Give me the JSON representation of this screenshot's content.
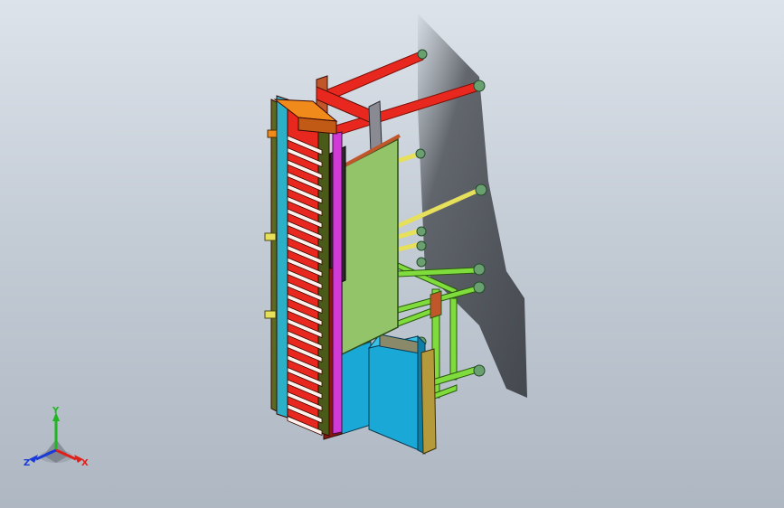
{
  "viewport": {
    "background_top": "#dde3ea",
    "background_bottom": "#aeb7c2"
  },
  "colors": {
    "red": "#e8281e",
    "dark_red": "#9c1a12",
    "orange": "#f08a1a",
    "green_panel": "#94c46a",
    "green_frame": "#7fdc3c",
    "yellow_arm": "#e6e05a",
    "cyan_box": "#1aa9d6",
    "olive": "#b49a3a",
    "magenta": "#d23ad8",
    "teal": "#2bb0c8",
    "shadow": "#55595f"
  },
  "triad": {
    "x_label": "X",
    "y_label": "Y",
    "z_label": "Z",
    "x_color": "#e0201a",
    "y_color": "#22b422",
    "z_color": "#1a3ad8"
  }
}
